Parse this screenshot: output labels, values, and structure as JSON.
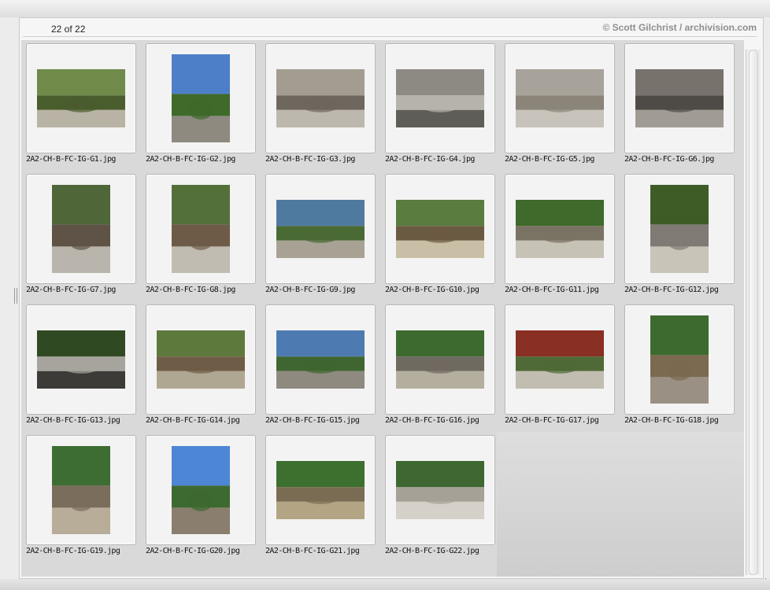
{
  "header": {
    "count": "22 of 22",
    "credit": "© Scott Gilchrist / archivision.com"
  },
  "thumbnails": [
    {
      "filename": "2A2-CH-B-FC-IG-G1.jpg",
      "orientation": "landscape",
      "colors": [
        "#6f8a49",
        "#4a5d2d",
        "#b8b3a4"
      ]
    },
    {
      "filename": "2A2-CH-B-FC-IG-G2.jpg",
      "orientation": "portrait",
      "colors": [
        "#4d7fc8",
        "#3f6a2a",
        "#8e8a80"
      ]
    },
    {
      "filename": "2A2-CH-B-FC-IG-G3.jpg",
      "orientation": "landscape",
      "colors": [
        "#a39d91",
        "#6e675d",
        "#bdb8ae"
      ]
    },
    {
      "filename": "2A2-CH-B-FC-IG-G4.jpg",
      "orientation": "landscape",
      "colors": [
        "#8c8a82",
        "#b6b3aa",
        "#5f5d57"
      ]
    },
    {
      "filename": "2A2-CH-B-FC-IG-G5.jpg",
      "orientation": "landscape",
      "colors": [
        "#a8a39a",
        "#8a8479",
        "#c8c3ba"
      ]
    },
    {
      "filename": "2A2-CH-B-FC-IG-G6.jpg",
      "orientation": "landscape",
      "colors": [
        "#77736c",
        "#4e4b46",
        "#a19c93"
      ]
    },
    {
      "filename": "2A2-CH-B-FC-IG-G7.jpg",
      "orientation": "portrait",
      "colors": [
        "#4f6738",
        "#5f5346",
        "#b9b5ac"
      ]
    },
    {
      "filename": "2A2-CH-B-FC-IG-G8.jpg",
      "orientation": "portrait",
      "colors": [
        "#54703a",
        "#6d5b48",
        "#c1bcb1"
      ]
    },
    {
      "filename": "2A2-CH-B-FC-IG-G9.jpg",
      "orientation": "landscape",
      "colors": [
        "#4f7a9f",
        "#4a6a34",
        "#a8a294"
      ]
    },
    {
      "filename": "2A2-CH-B-FC-IG-G10.jpg",
      "orientation": "landscape",
      "colors": [
        "#5a7c3f",
        "#6b5a42",
        "#c8bfa6"
      ]
    },
    {
      "filename": "2A2-CH-B-FC-IG-G11.jpg",
      "orientation": "landscape",
      "colors": [
        "#3f6a2c",
        "#7a7263",
        "#c7c2b6"
      ]
    },
    {
      "filename": "2A2-CH-B-FC-IG-G12.jpg",
      "orientation": "portrait",
      "colors": [
        "#3e5c26",
        "#7f7b74",
        "#c9c4b8"
      ]
    },
    {
      "filename": "2A2-CH-B-FC-IG-G13.jpg",
      "orientation": "landscape",
      "colors": [
        "#2f4a22",
        "#a7a49e",
        "#3c3b38"
      ]
    },
    {
      "filename": "2A2-CH-B-FC-IG-G14.jpg",
      "orientation": "landscape",
      "colors": [
        "#5d7a3c",
        "#6e5c46",
        "#b0a793"
      ]
    },
    {
      "filename": "2A2-CH-B-FC-IG-G15.jpg",
      "orientation": "landscape",
      "colors": [
        "#4d7bb1",
        "#3f6530",
        "#8f8a80"
      ]
    },
    {
      "filename": "2A2-CH-B-FC-IG-G16.jpg",
      "orientation": "landscape",
      "colors": [
        "#3d6a2f",
        "#6f6a5f",
        "#b4ae9f"
      ]
    },
    {
      "filename": "2A2-CH-B-FC-IG-G17.jpg",
      "orientation": "landscape",
      "colors": [
        "#8a2f24",
        "#4f6a36",
        "#c2bdb1"
      ]
    },
    {
      "filename": "2A2-CH-B-FC-IG-G18.jpg",
      "orientation": "portrait",
      "colors": [
        "#3d6a2e",
        "#7b6a4f",
        "#9a9184"
      ]
    },
    {
      "filename": "2A2-CH-B-FC-IG-G19.jpg",
      "orientation": "portrait",
      "colors": [
        "#3e6d33",
        "#7a6d5c",
        "#b7ad98"
      ]
    },
    {
      "filename": "2A2-CH-B-FC-IG-G20.jpg",
      "orientation": "portrait",
      "colors": [
        "#4d86d4",
        "#3d6a30",
        "#8a7f6f"
      ]
    },
    {
      "filename": "2A2-CH-B-FC-IG-G21.jpg",
      "orientation": "landscape",
      "colors": [
        "#3d6f2f",
        "#7a6c52",
        "#b3a583"
      ]
    },
    {
      "filename": "2A2-CH-B-FC-IG-G22.jpg",
      "orientation": "landscape",
      "colors": [
        "#3e6731",
        "#a6a197",
        "#d5d1c8"
      ]
    }
  ],
  "icons": {
    "scrollbar": "scrollbar",
    "splitter": "splitter-grip-icon",
    "resize": "resize-grip-icon"
  }
}
